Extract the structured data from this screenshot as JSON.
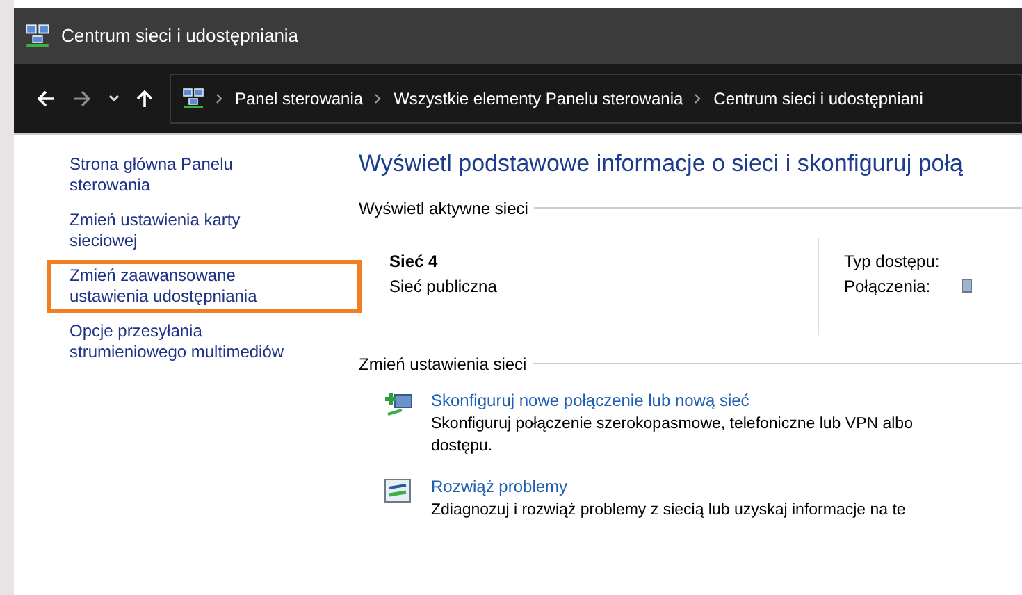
{
  "window": {
    "title": "Centrum sieci i udostępniania"
  },
  "address_bar": {
    "breadcrumbs": [
      "Panel sterowania",
      "Wszystkie elementy Panelu sterowania",
      "Centrum sieci i udostępniani"
    ]
  },
  "sidebar": {
    "items": [
      {
        "label": "Strona główna Panelu sterowania",
        "highlighted": false
      },
      {
        "label": "Zmień ustawienia karty sieciowej",
        "highlighted": false
      },
      {
        "label": "Zmień zaawansowane ustawienia udostępniania",
        "highlighted": true
      },
      {
        "label": "Opcje przesyłania strumieniowego multimediów",
        "highlighted": false
      }
    ]
  },
  "main": {
    "heading": "Wyświetl podstawowe informacje o sieci i skonfiguruj połą",
    "active_networks": {
      "title": "Wyświetl aktywne sieci",
      "name": "Sieć 4",
      "type": "Sieć publiczna",
      "access_label": "Typ dostępu:",
      "connections_label": "Połączenia:"
    },
    "change_settings": {
      "title": "Zmień ustawienia sieci",
      "tasks": [
        {
          "kind": "new",
          "link": "Skonfiguruj nowe połączenie lub nową sieć",
          "description": "Skonfiguruj połączenie szerokopasmowe, telefoniczne lub VPN albo",
          "description_2": "dostępu."
        },
        {
          "kind": "troubleshoot",
          "link": "Rozwiąż problemy",
          "description": "Zdiagnozuj i rozwiąż problemy z siecią lub uzyskaj informacje na te"
        }
      ]
    }
  }
}
